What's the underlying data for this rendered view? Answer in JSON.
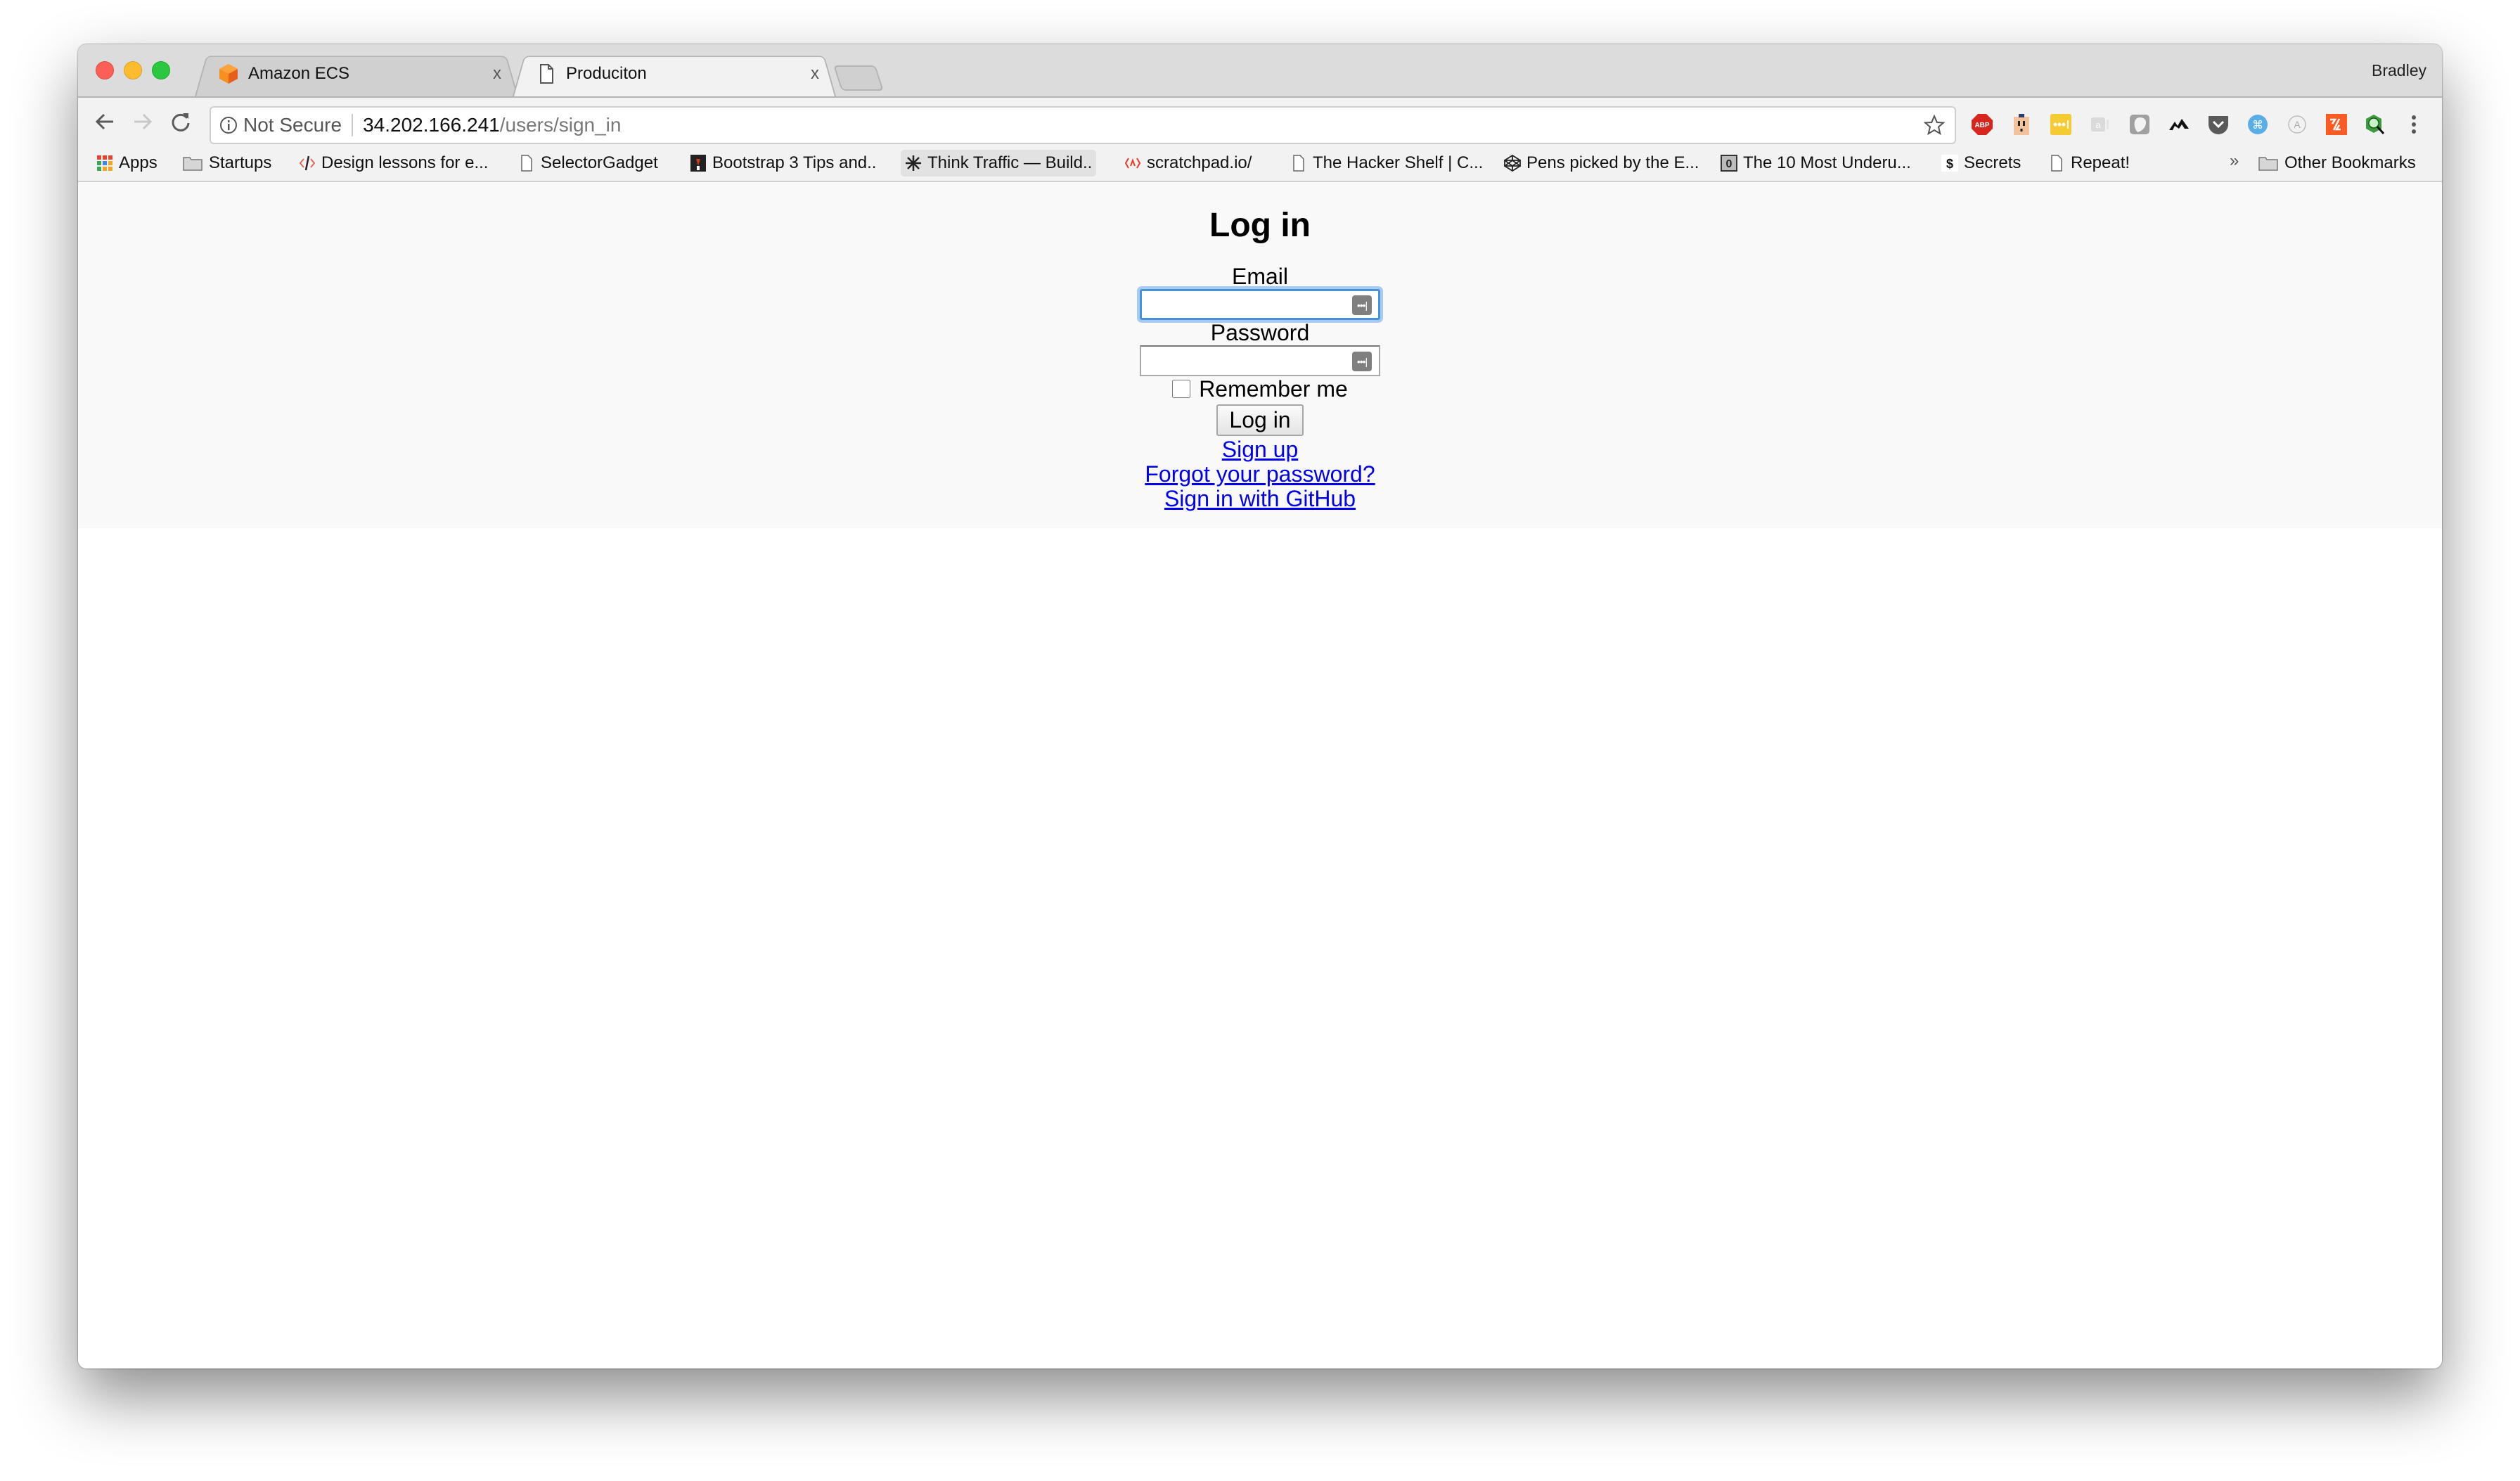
{
  "browser": {
    "tabs": [
      {
        "title": "Amazon ECS",
        "favicon": "aws-cube-icon",
        "active": false
      },
      {
        "title": "Produciton",
        "favicon": "page-icon",
        "active": true
      }
    ],
    "close_glyph": "x",
    "profile_name": "Bradley",
    "address_bar": {
      "security_label": "Not Secure",
      "host": "34.202.166.241",
      "path": "/users/sign_in"
    },
    "extensions": [
      "adblock-plus-icon",
      "outlet-icon",
      "lastpass-icon",
      "ghostery-icon",
      "shield-icon",
      "momentum-icon",
      "pocket-icon",
      "shortcut-icon",
      "a-circle-icon",
      "codepen-orange-icon",
      "rss-search-icon"
    ],
    "bookmarks": [
      {
        "label": "Apps",
        "icon": "apps-grid-icon"
      },
      {
        "label": "Startups",
        "icon": "folder-icon"
      },
      {
        "label": "Design lessons for e...",
        "icon": "code-slash-icon"
      },
      {
        "label": "SelectorGadget",
        "icon": "page-icon"
      },
      {
        "label": "Bootstrap 3 Tips and..",
        "icon": "bootstrap-icon"
      },
      {
        "label": "Think Traffic — Build..",
        "icon": "starburst-icon"
      },
      {
        "label": "scratchpad.io/",
        "icon": "scratchpad-icon"
      },
      {
        "label": "The Hacker Shelf | C...",
        "icon": "page-icon"
      },
      {
        "label": "Pens picked by the E...",
        "icon": "codepen-icon"
      },
      {
        "label": "The 10 Most Underu...",
        "icon": "zero-icon"
      },
      {
        "label": "Secrets",
        "icon": "dollar-icon"
      },
      {
        "label": "Repeat!",
        "icon": "page-icon"
      }
    ],
    "overflow_glyph": "»",
    "other_bookmarks": "Other Bookmarks",
    "colors": {
      "tabstrip": "#dcdcdc",
      "toolbar": "#f2f2f2",
      "link": "#0000ee",
      "focus_ring": "#4a90d9"
    }
  },
  "page": {
    "heading": "Log in",
    "email_label": "Email",
    "email_value": "",
    "password_label": "Password",
    "password_value": "",
    "remember_label": "Remember me",
    "remember_checked": false,
    "submit_label": "Log in",
    "links": [
      "Sign up",
      "Forgot your password?",
      "Sign in with GitHub"
    ],
    "key_icon_glyph": "•••|"
  }
}
